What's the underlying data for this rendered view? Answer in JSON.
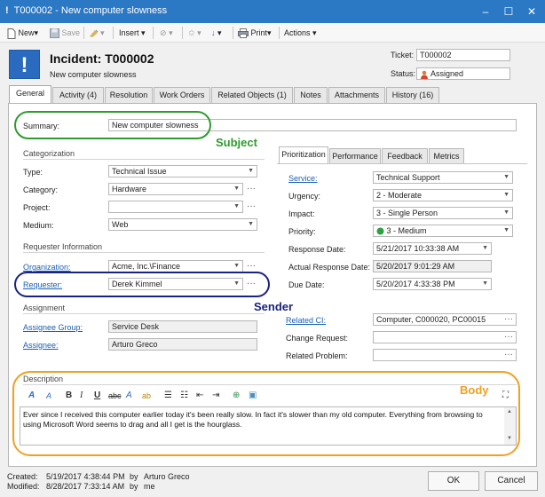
{
  "window": {
    "title": "T000002 - New computer slowness",
    "prefix": "!",
    "min": "–",
    "max": "☐",
    "close": "✕"
  },
  "toolbar": {
    "new_label": "New",
    "save_label": "Save",
    "insert_label": "Insert",
    "print_label": "Print",
    "actions_label": "Actions"
  },
  "header": {
    "icon": "!",
    "title": "Incident: T000002",
    "subtitle": "New computer slowness",
    "ticket_label": "Ticket:",
    "ticket_value": "T000002",
    "status_label": "Status:",
    "status_value": "Assigned"
  },
  "tabs": [
    {
      "label": "General"
    },
    {
      "label": "Activity (4)"
    },
    {
      "label": "Resolution"
    },
    {
      "label": "Work Orders"
    },
    {
      "label": "Related Objects (1)"
    },
    {
      "label": "Notes"
    },
    {
      "label": "Attachments"
    },
    {
      "label": "History (16)"
    }
  ],
  "summary": {
    "label": "Summary:",
    "value": "New computer slowness"
  },
  "categorization": {
    "section": "Categorization",
    "type_label": "Type:",
    "type_value": "Technical Issue",
    "category_label": "Category:",
    "category_value": "Hardware",
    "project_label": "Project:",
    "project_value": "",
    "medium_label": "Medium:",
    "medium_value": "Web"
  },
  "requester": {
    "section": "Requester Information",
    "org_label": "Organization:",
    "org_value": "Acme, Inc.\\Finance",
    "req_label": "Requester:",
    "req_value": "Derek Kimmel"
  },
  "assignment": {
    "section": "Assignment",
    "group_label": "Assignee Group:",
    "group_value": "Service Desk",
    "assignee_label": "Assignee:",
    "assignee_value": "Arturo Greco"
  },
  "subtabs": [
    {
      "label": "Prioritization"
    },
    {
      "label": "Performance"
    },
    {
      "label": "Feedback"
    },
    {
      "label": "Metrics"
    }
  ],
  "prioritization": {
    "service_label": "Service:",
    "service_value": "Technical Support",
    "urgency_label": "Urgency:",
    "urgency_value": "2 - Moderate",
    "impact_label": "Impact:",
    "impact_value": "3 - Single Person",
    "priority_label": "Priority:",
    "priority_value": "3 - Medium",
    "response_label": "Response Date:",
    "response_value": "5/21/2017 10:33:38 AM",
    "actual_label": "Actual Response Date:",
    "actual_value": "5/20/2017 9:01:29 AM",
    "due_label": "Due Date:",
    "due_value": "5/20/2017 4:33:38 PM"
  },
  "related": {
    "ci_label": "Related CI:",
    "ci_value": "Computer, C000020, PC00015",
    "change_label": "Change Request:",
    "change_value": "",
    "problem_label": "Related Problem:",
    "problem_value": ""
  },
  "description": {
    "section": "Description",
    "body": "Ever since I received this computer earlier today it's been really slow. In fact it's slower than my old computer. Everything from browsing to using Microsoft Word seems to drag and all I get is the hourglass."
  },
  "annotations": {
    "subject": "Subject",
    "sender": "Sender",
    "body": "Body"
  },
  "footer": {
    "created_label": "Created:",
    "created_date": "5/19/2017 4:38:44 PM",
    "created_by_label": "by",
    "created_by": "Arturo Greco",
    "modified_label": "Modified:",
    "modified_date": "8/28/2017 7:33:14 AM",
    "modified_by_label": "by",
    "modified_by": "me",
    "ok_label": "OK",
    "cancel_label": "Cancel"
  },
  "colors": {
    "titlebar": "#2b78c5",
    "link": "#1a5fb4",
    "subject": "#2e9b2e",
    "sender": "#1a237e",
    "body": "#f0a020"
  }
}
